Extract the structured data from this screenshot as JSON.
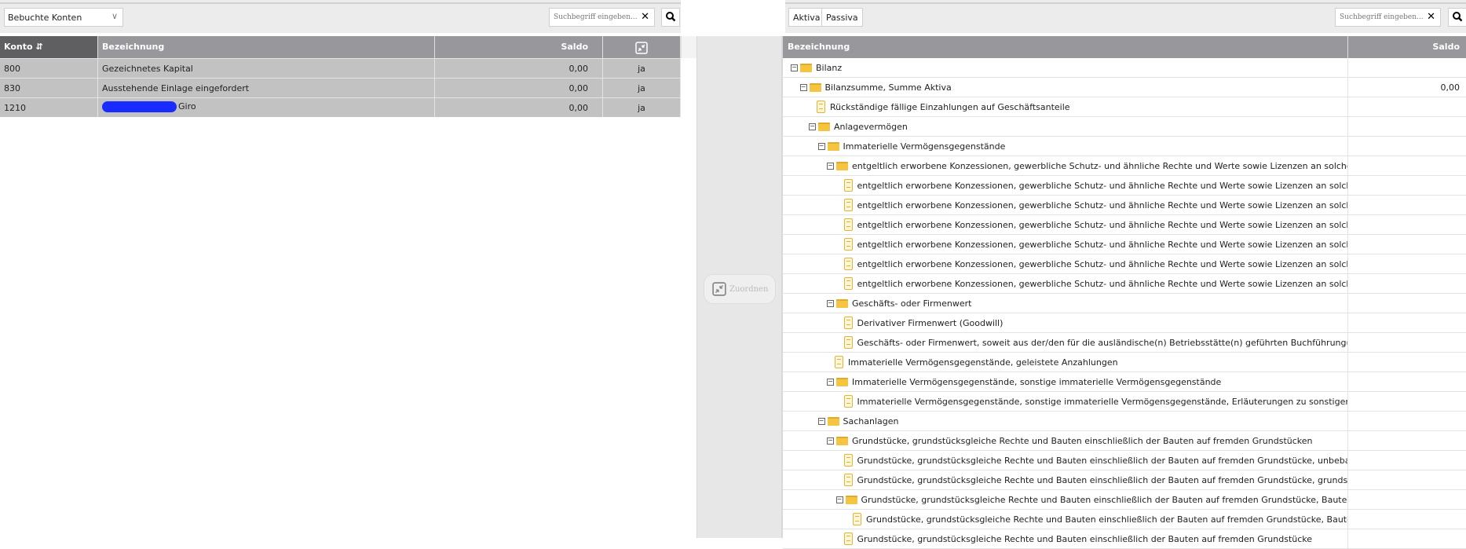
{
  "left": {
    "filter_select": "Bebuchte Konten",
    "search_placeholder": "Suchbegriff eingeben...",
    "columns": {
      "konto": "Konto",
      "bezeichnung": "Bezeichnung",
      "saldo": "Saldo"
    },
    "rows": [
      {
        "konto": "800",
        "bezeichnung": "Gezeichnetes Kapital",
        "saldo": "0,00",
        "zugeordnet": "ja"
      },
      {
        "konto": "830",
        "bezeichnung": "Ausstehende Einlage eingefordert",
        "saldo": "0,00",
        "zugeordnet": "ja"
      },
      {
        "konto": "1210",
        "bezeichnung": "Giro",
        "saldo": "0,00",
        "zugeordnet": "ja"
      }
    ]
  },
  "middle": {
    "assign_label": "Zuordnen"
  },
  "right": {
    "tabs": [
      "Aktiva",
      "Passiva"
    ],
    "search_placeholder": "Suchbegriff eingeben...",
    "columns": {
      "bezeichnung": "Bezeichnung",
      "saldo": "Saldo"
    },
    "tree": [
      {
        "level": 0,
        "type": "folder",
        "label": "Bilanz",
        "saldo": ""
      },
      {
        "level": 1,
        "type": "folder",
        "label": "Bilanzsumme, Summe Aktiva",
        "saldo": "0,00"
      },
      {
        "level": 2,
        "type": "leaf",
        "label": "Rückständige fällige Einzahlungen auf Geschäftsanteile",
        "saldo": ""
      },
      {
        "level": 2,
        "type": "folder",
        "label": "Anlagevermögen",
        "saldo": ""
      },
      {
        "level": 3,
        "type": "folder",
        "label": "Immaterielle Vermögensgegenstände",
        "saldo": ""
      },
      {
        "level": 4,
        "type": "folder",
        "label": "entgeltlich erworbene Konzessionen, gewerbliche Schutz- und ähnliche Rechte und Werte sowie Lizenzen an solchen Rechten und",
        "saldo": ""
      },
      {
        "level": 5,
        "type": "leaf",
        "label": "entgeltlich erworbene Konzessionen, gewerbliche Schutz- und ähnliche Rechte und Werte sowie Lizenzen an solchen Rechten un",
        "saldo": ""
      },
      {
        "level": 5,
        "type": "leaf",
        "label": "entgeltlich erworbene Konzessionen, gewerbliche Schutz- und ähnliche Rechte und Werte sowie Lizenzen an solchen Rechten un",
        "saldo": ""
      },
      {
        "level": 5,
        "type": "leaf",
        "label": "entgeltlich erworbene Konzessionen, gewerbliche Schutz- und ähnliche Rechte und Werte sowie Lizenzen an solchen Rechten un",
        "saldo": ""
      },
      {
        "level": 5,
        "type": "leaf",
        "label": "entgeltlich erworbene Konzessionen, gewerbliche Schutz- und ähnliche Rechte und Werte sowie Lizenzen an solchen Rechten un",
        "saldo": ""
      },
      {
        "level": 5,
        "type": "leaf",
        "label": "entgeltlich erworbene Konzessionen, gewerbliche Schutz- und ähnliche Rechte und Werte sowie Lizenzen an solchen Rechten un",
        "saldo": ""
      },
      {
        "level": 5,
        "type": "leaf",
        "label": "entgeltlich erworbene Konzessionen, gewerbliche Schutz- und ähnliche Rechte und Werte sowie Lizenzen an solchen Rechten un",
        "saldo": ""
      },
      {
        "level": 4,
        "type": "folder",
        "label": "Geschäfts- oder Firmenwert",
        "saldo": ""
      },
      {
        "level": 5,
        "type": "leaf",
        "label": "Derivativer Firmenwert (Goodwill)",
        "saldo": ""
      },
      {
        "level": 5,
        "type": "leaf",
        "label": "Geschäfts- oder Firmenwert, soweit aus der/den für die ausländische(n) Betriebsstätte(n) geführten Buchführung(en) nicht anders",
        "saldo": ""
      },
      {
        "level": 4,
        "type": "leaf",
        "label": "Immaterielle Vermögensgegenstände, geleistete Anzahlungen",
        "saldo": ""
      },
      {
        "level": 4,
        "type": "folder",
        "label": "Immaterielle Vermögensgegenstände, sonstige immaterielle Vermögensgegenstände",
        "saldo": ""
      },
      {
        "level": 5,
        "type": "leaf",
        "label": "Immaterielle Vermögensgegenstände, sonstige immaterielle Vermögensgegenstände, Erläuterungen zu sonstigen immateriellen",
        "saldo": ""
      },
      {
        "level": 3,
        "type": "folder",
        "label": "Sachanlagen",
        "saldo": ""
      },
      {
        "level": 4,
        "type": "folder",
        "label": "Grundstücke, grundstücksgleiche Rechte und Bauten einschließlich der Bauten auf fremden Grundstücken",
        "saldo": ""
      },
      {
        "level": 5,
        "type": "leaf",
        "label": "Grundstücke, grundstücksgleiche Rechte und Bauten einschließlich der Bauten auf fremden Grundstücke, unbebaute Grundstück",
        "saldo": ""
      },
      {
        "level": 5,
        "type": "leaf",
        "label": "Grundstücke, grundstücksgleiche Rechte und Bauten einschließlich der Bauten auf fremden Grundstücke, grundstücksgleiche Re",
        "saldo": ""
      },
      {
        "level": 5,
        "type": "folder",
        "label": "Grundstücke, grundstücksgleiche Rechte und Bauten einschließlich der Bauten auf fremden Grundstücke, Bauten auf eigenen Gr",
        "saldo": ""
      },
      {
        "level": 6,
        "type": "leaf",
        "label": "Grundstücke, grundstücksgleiche Rechte und Bauten einschließlich der Bauten auf fremden Grundstücke, Bauten auf eigenen G",
        "saldo": ""
      },
      {
        "level": 5,
        "type": "leaf",
        "label": "Grundstücke, grundstücksgleiche Rechte und Bauten einschließlich der Bauten auf fremden Grundstücke",
        "saldo": ""
      }
    ]
  }
}
